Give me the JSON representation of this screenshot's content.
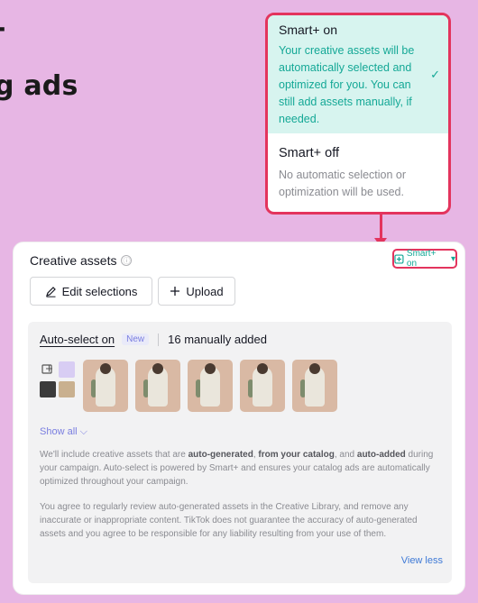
{
  "slide": {
    "line1": "-",
    "line2": "g ads"
  },
  "dropdown": {
    "option_on": {
      "title": "Smart+ on",
      "description": "Your creative assets will be automatically selected and optimized for you. You can still add assets manually, if needed.",
      "check": "✓"
    },
    "option_off": {
      "title": "Smart+ off",
      "description": "No automatic selection or optimization will be used."
    }
  },
  "panel": {
    "title": "Creative assets",
    "info_icon": "ⓘ",
    "smart_toggle_label": "Smart+ on",
    "toggle_caret": "▾",
    "edit_button": "Edit selections",
    "upload_button": "Upload",
    "tab_auto_select": "Auto-select on",
    "new_badge": "New",
    "tab_manual": "16 manually added",
    "show_all": "Show all",
    "show_all_chevron": "⌵",
    "para1": {
      "t1": "We'll include creative assets that are ",
      "b1": "auto-generated",
      "t2": ", ",
      "b2": "from your catalog",
      "t3": ", and ",
      "b3": "auto-added",
      "t4": " during your campaign. Auto-select is powered by Smart+ and ensures your catalog ads are automatically optimized throughout your campaign."
    },
    "para2": "You agree to regularly review auto-generated assets in the Creative Library, and remove any inaccurate or inappropriate content. TikTok does not guarantee the accuracy of auto-generated assets and you agree to be responsible for any liability resulting from your use of them.",
    "view_less": "View less"
  },
  "colors": {
    "accent_teal": "#14a896",
    "highlight_red": "#e3345d",
    "background": "#e7b6e4"
  }
}
